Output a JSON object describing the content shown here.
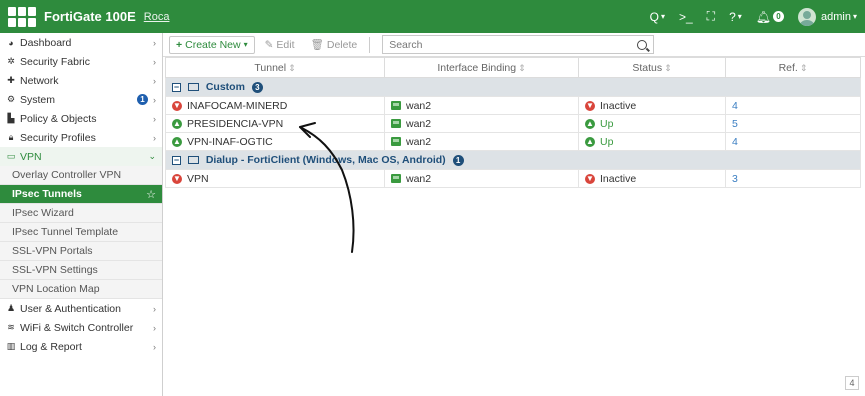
{
  "topbar": {
    "product": "FortiGate 100E",
    "hostname": "Roca",
    "right_icons": [
      "search-icon",
      "cli-icon",
      "fullscreen-icon",
      "help-icon",
      "notification-icon"
    ],
    "notif_count": "0",
    "user": "admin"
  },
  "sidebar": {
    "items": [
      {
        "label": "Dashboard",
        "icon": "dashboard-icon"
      },
      {
        "label": "Security Fabric",
        "icon": "fabric-icon"
      },
      {
        "label": "Network",
        "icon": "network-icon"
      },
      {
        "label": "System",
        "icon": "gear-icon",
        "badge": "1"
      },
      {
        "label": "Policy & Objects",
        "icon": "policy-icon"
      },
      {
        "label": "Security Profiles",
        "icon": "lock-icon"
      },
      {
        "label": "VPN",
        "icon": "monitor-icon"
      }
    ],
    "vpn_sub": [
      "Overlay Controller VPN",
      "IPsec Tunnels",
      "IPsec Wizard",
      "IPsec Tunnel Template",
      "SSL-VPN Portals",
      "SSL-VPN Settings",
      "VPN Location Map"
    ],
    "bottom": [
      {
        "label": "User & Authentication",
        "icon": "user-icon"
      },
      {
        "label": "WiFi & Switch Controller",
        "icon": "wifi-icon"
      },
      {
        "label": "Log & Report",
        "icon": "chart-icon"
      }
    ]
  },
  "toolbar": {
    "create_new": "Create New",
    "edit": "Edit",
    "delete": "Delete",
    "search_placeholder": "Search"
  },
  "table": {
    "headers": [
      "Tunnel",
      "Interface Binding",
      "Status",
      "Ref."
    ],
    "groups": [
      {
        "name": "Custom",
        "count": "3",
        "rows": [
          {
            "tunnel": "INAFOCAM-MINERD",
            "interface": "wan2",
            "status": "Inactive",
            "ref": "4",
            "up": false
          },
          {
            "tunnel": "PRESIDENCIA-VPN",
            "interface": "wan2",
            "status": "Up",
            "ref": "5",
            "up": true
          },
          {
            "tunnel": "VPN-INAF-OGTIC",
            "interface": "wan2",
            "status": "Up",
            "ref": "4",
            "up": true
          }
        ]
      },
      {
        "name": "Dialup - FortiClient (Windows, Mac OS, Android)",
        "count": "1",
        "rows": [
          {
            "tunnel": "VPN",
            "interface": "wan2",
            "status": "Inactive",
            "ref": "3",
            "up": false
          }
        ]
      }
    ]
  },
  "footer": {
    "page_indicator": "4"
  }
}
